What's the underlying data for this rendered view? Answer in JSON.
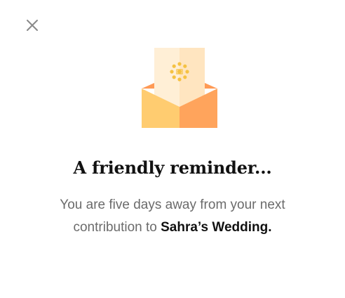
{
  "modal": {
    "title": "A friendly reminder...",
    "message_before": "You are five days away from your next contribution to ",
    "highlight": "Sahra’s Wedding.",
    "close_icon": "close-icon",
    "illustration_icon": "envelope-letter-icon"
  },
  "colors": {
    "envelope_left": "#FFCC70",
    "envelope_right": "#FFA45C",
    "envelope_back": "#FF9A55",
    "letter": "#FFEFD6",
    "letter_fold": "#FFE5C0",
    "seal": "#F5C242",
    "close": "#8a8a8a"
  }
}
